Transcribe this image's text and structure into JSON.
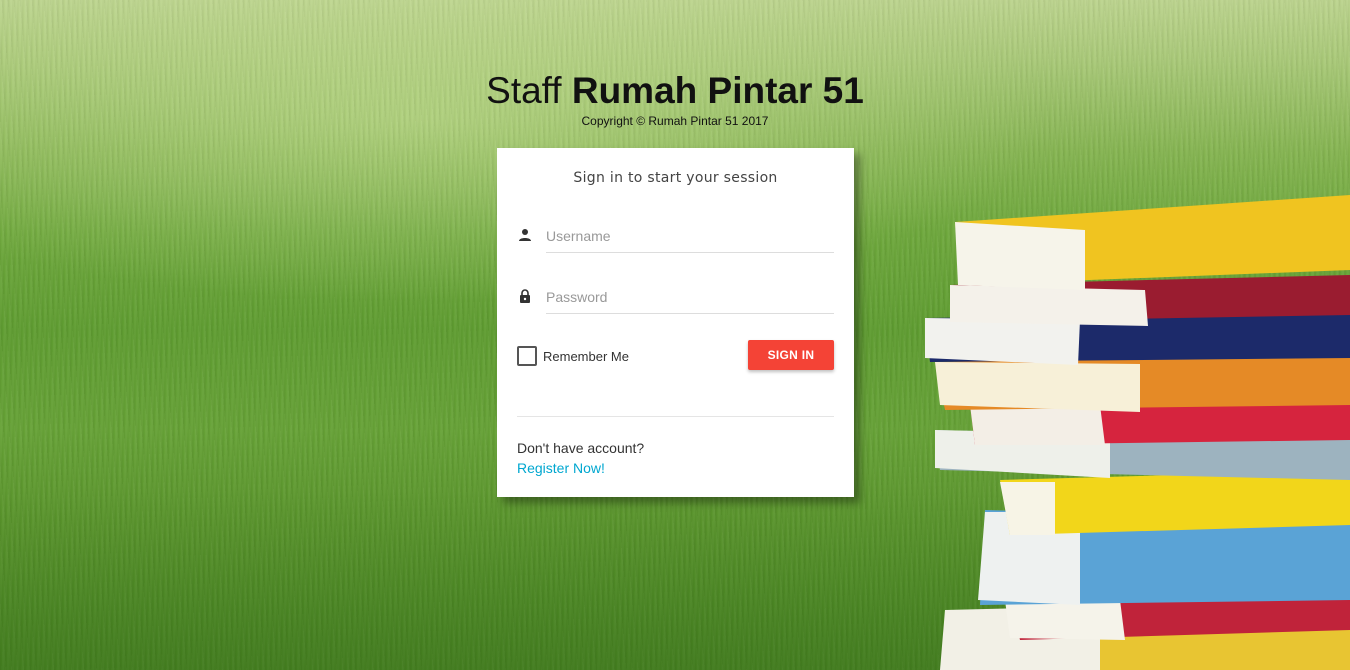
{
  "brand": {
    "title_light": "Staff",
    "title_bold": "Rumah Pintar 51",
    "copyright": "Copyright © Rumah Pintar 51 2017"
  },
  "login": {
    "message": "Sign in to start your session",
    "username_placeholder": "Username",
    "password_placeholder": "Password",
    "remember_label": "Remember Me",
    "signin_label": "SIGN IN",
    "no_account_text": "Don't have account?",
    "register_label": "Register Now!"
  },
  "icons": {
    "username": "person-icon",
    "password": "lock-icon"
  },
  "colors": {
    "signin_button": "#f44336",
    "link": "#00a7d0",
    "card_background": "#ffffff"
  }
}
